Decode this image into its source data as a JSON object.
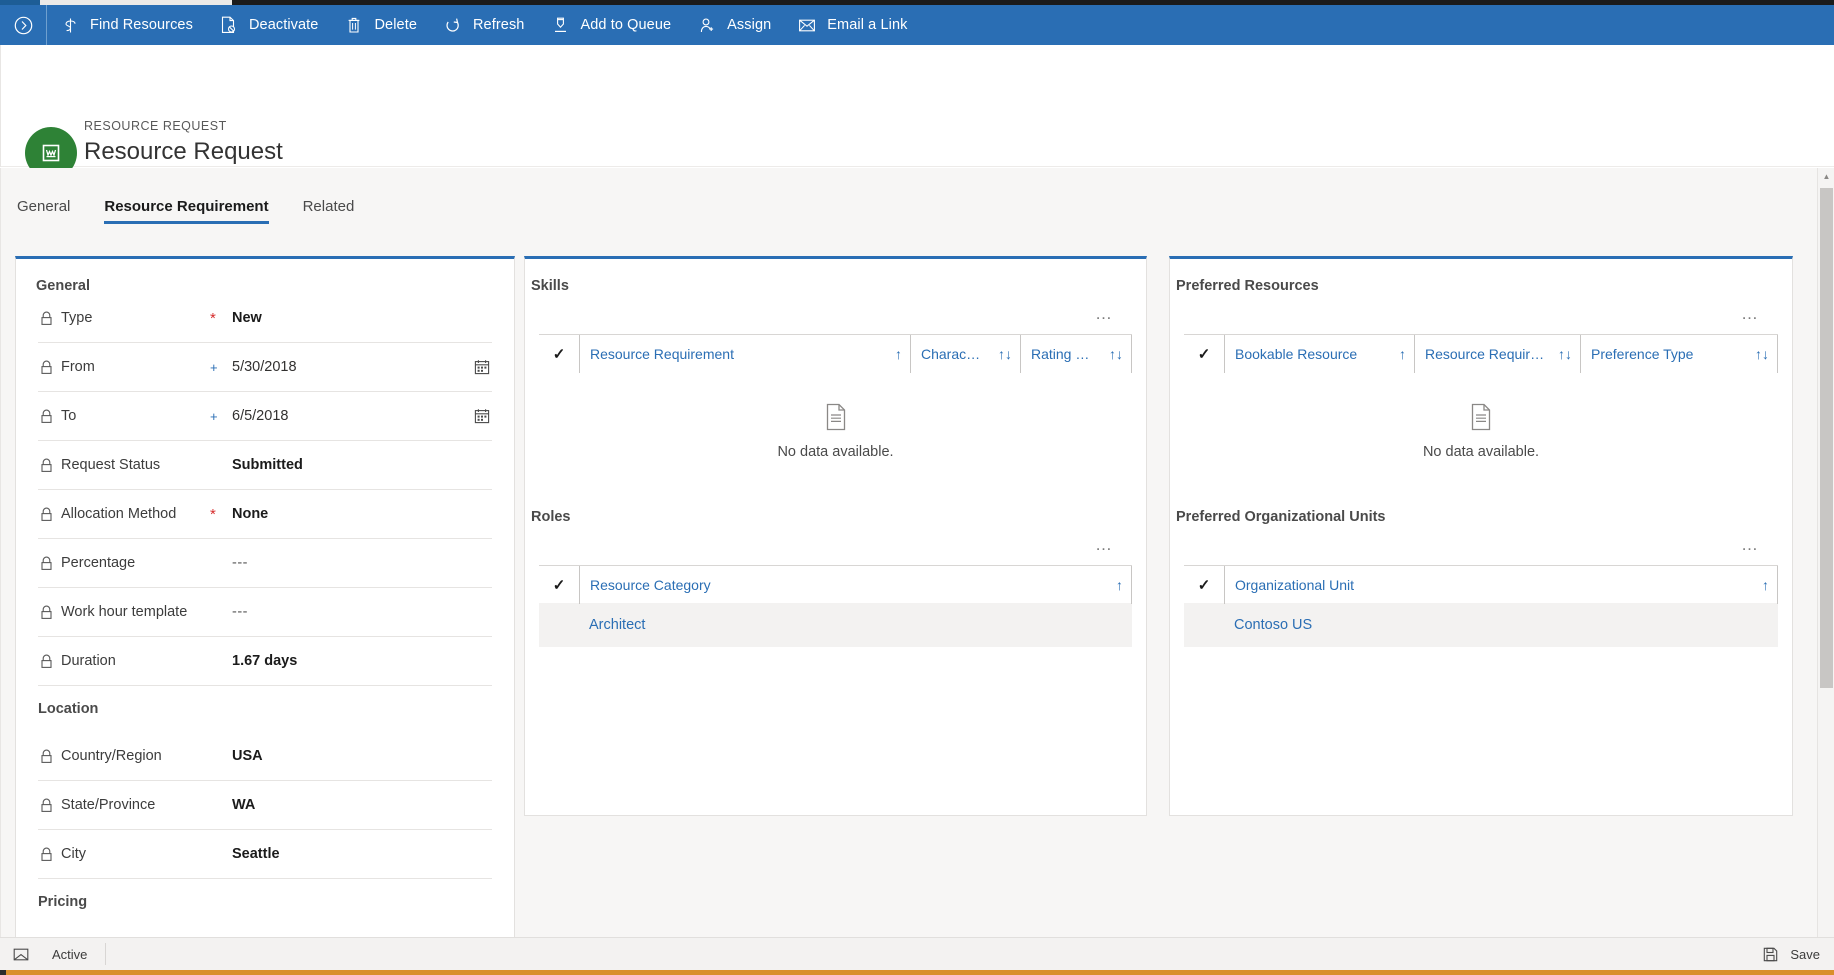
{
  "commandbar": {
    "back_icon": "circle-chevron-right-icon",
    "items": [
      {
        "label": "Find Resources",
        "icon": "find-resources-icon"
      },
      {
        "label": "Deactivate",
        "icon": "deactivate-page-icon"
      },
      {
        "label": "Delete",
        "icon": "trash-icon"
      },
      {
        "label": "Refresh",
        "icon": "refresh-icon"
      },
      {
        "label": "Add to Queue",
        "icon": "add-to-queue-icon"
      },
      {
        "label": "Assign",
        "icon": "assign-person-icon"
      },
      {
        "label": "Email a Link",
        "icon": "email-link-icon"
      }
    ]
  },
  "record_header": {
    "eyebrow": "RESOURCE REQUEST",
    "title": "Resource Request",
    "avatar_icon": "resource-request-entity-icon",
    "avatar_color": "#2e8236"
  },
  "tabs": [
    {
      "label": "General",
      "active": false
    },
    {
      "label": "Resource Requirement",
      "active": true
    },
    {
      "label": "Related",
      "active": false
    }
  ],
  "general_card": {
    "section_title": "General",
    "rows": [
      {
        "label": "Type",
        "required": "star",
        "value": "New",
        "style": "bold",
        "calendar": false
      },
      {
        "label": "From",
        "required": "plus",
        "value": "5/30/2018",
        "style": "plain",
        "calendar": true
      },
      {
        "label": "To",
        "required": "plus",
        "value": "6/5/2018",
        "style": "plain",
        "calendar": true
      },
      {
        "label": "Request Status",
        "required": "",
        "value": "Submitted",
        "style": "bold",
        "calendar": false
      },
      {
        "label": "Allocation Method",
        "required": "star",
        "value": "None",
        "style": "bold",
        "calendar": false
      },
      {
        "label": "Percentage",
        "required": "",
        "value": "---",
        "style": "dim",
        "calendar": false
      },
      {
        "label": "Work hour template",
        "required": "",
        "value": "---",
        "style": "dim",
        "calendar": false
      },
      {
        "label": "Duration",
        "required": "",
        "value": "1.67 days",
        "style": "bold",
        "calendar": false
      }
    ],
    "location_title": "Location",
    "location_rows": [
      {
        "label": "Country/Region",
        "required": "",
        "value": "USA",
        "style": "bold",
        "calendar": false
      },
      {
        "label": "State/Province",
        "required": "",
        "value": "WA",
        "style": "bold",
        "calendar": false
      },
      {
        "label": "City",
        "required": "",
        "value": "Seattle",
        "style": "bold",
        "calendar": false
      }
    ],
    "pricing_title": "Pricing"
  },
  "skills_grid": {
    "title": "Skills",
    "more_label": "…",
    "select_all_icon": "checkmark-icon",
    "columns": [
      {
        "label": "Resource Requirement",
        "sort": "↑"
      },
      {
        "label": "Charac…",
        "sort": "↑↓"
      },
      {
        "label": "Rating …",
        "sort": "↑↓"
      }
    ],
    "empty_text": "No data available.",
    "empty_icon": "document-empty-icon"
  },
  "roles_grid": {
    "title": "Roles",
    "more_label": "…",
    "select_all_icon": "checkmark-icon",
    "columns": [
      {
        "label": "Resource Category",
        "sort": "↑"
      }
    ],
    "rows": [
      {
        "value": "Architect"
      }
    ]
  },
  "preferred_resources_grid": {
    "title": "Preferred Resources",
    "more_label": "…",
    "select_all_icon": "checkmark-icon",
    "columns": [
      {
        "label": "Bookable Resource",
        "sort": "↑"
      },
      {
        "label": "Resource Require…",
        "sort": "↑↓"
      },
      {
        "label": "Preference Type",
        "sort": "↑↓"
      }
    ],
    "empty_text": "No data available.",
    "empty_icon": "document-empty-icon"
  },
  "preferred_org_units_grid": {
    "title": "Preferred Organizational Units",
    "more_label": "…",
    "select_all_icon": "checkmark-icon",
    "columns": [
      {
        "label": "Organizational Unit",
        "sort": "↑"
      }
    ],
    "rows": [
      {
        "value": "Contoso US"
      }
    ]
  },
  "footer": {
    "left_icon": "form-state-icon",
    "status": "Active",
    "save_icon": "save-icon",
    "save_label": "Save"
  },
  "colors": {
    "accent": "#2a6eb4",
    "command_bar": "#2a6eb4",
    "required_star": "#d62c2c",
    "link": "#2a6eb4",
    "avatar": "#2e8236",
    "bottom_bar": "#d98f2b"
  }
}
